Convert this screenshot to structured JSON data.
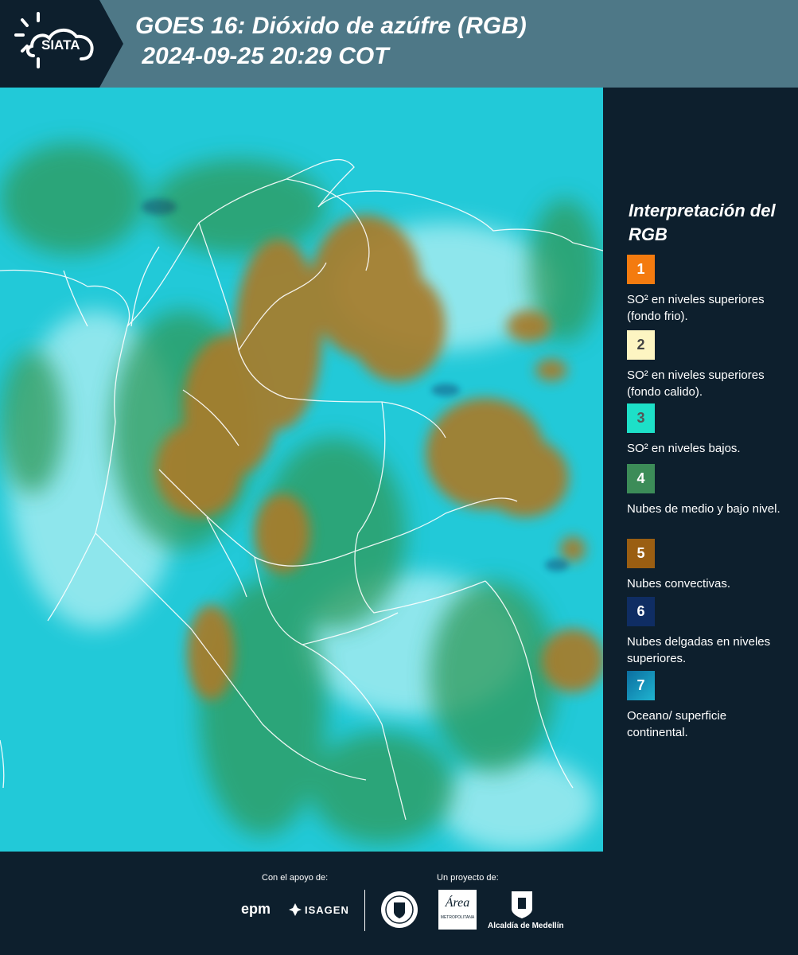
{
  "header": {
    "logo_text": "SIATA",
    "title_line1": "GOES 16: Dióxido de azúfre (RGB)",
    "title_line2": " 2024-09-25 20:29 COT"
  },
  "legend": {
    "title": "Interpretación del RGB",
    "items": [
      {
        "num": "1",
        "color": "#f47b0f",
        "label": "SO² en niveles superiores (fondo frio)."
      },
      {
        "num": "2",
        "color": "#fdf5c2",
        "label": "SO² en niveles superiores (fondo calido)."
      },
      {
        "num": "3",
        "color": "#1de0c8",
        "label": "SO² en niveles bajos."
      },
      {
        "num": "4",
        "color": "#3c8c58",
        "label": "Nubes de medio y bajo nivel."
      },
      {
        "num": "5",
        "color": "#9a5e12",
        "label": "Nubes convectivas."
      },
      {
        "num": "6",
        "color": "#0f2d63",
        "label": "Nubes delgadas en niveles superiores."
      },
      {
        "num": "7",
        "color": "#1490b8",
        "label": "Oceano/ superficie continental."
      }
    ]
  },
  "footer": {
    "support_label": "Con el apoyo de:",
    "project_label": "Un proyecto de:",
    "epm_label": "epm",
    "isagen_label": "ISAGEN",
    "area_label": "Área",
    "area_sub": "METROPOLITANA",
    "alcaldia_label": "Alcaldía de Medellín"
  }
}
